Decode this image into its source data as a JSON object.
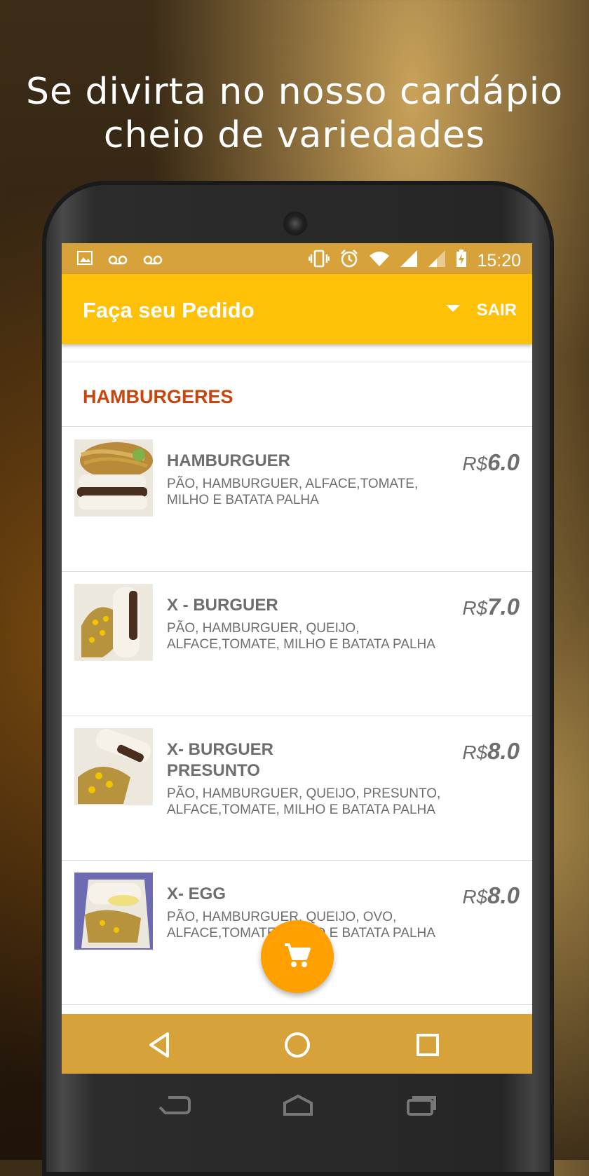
{
  "promo": {
    "headline_line1": "Se divirta no nosso cardápio",
    "headline_line2": "cheio de variedades"
  },
  "statusbar": {
    "time": "15:20",
    "icons_left": [
      "image-icon",
      "voicemail-icon",
      "voicemail-icon"
    ],
    "icons_right": [
      "vibrate-icon",
      "alarm-icon",
      "wifi-icon",
      "signal-icon",
      "signal-icon",
      "battery-charging-icon"
    ]
  },
  "appbar": {
    "title": "Faça seu Pedido",
    "dropdown_icon": "arrow-drop-down-icon",
    "logout_label": "SAIR"
  },
  "menu": {
    "category": "HAMBURGERES",
    "items": [
      {
        "name": "HAMBURGUER",
        "description": "PÃO, HAMBURGUER, ALFACE,TOMATE, MILHO E BATATA PALHA",
        "currency": "R$",
        "price": "6.0"
      },
      {
        "name": "X - BURGUER",
        "description": "PÃO, HAMBURGUER, QUEIJO, ALFACE,TOMATE, MILHO E BATATA PALHA",
        "currency": "R$",
        "price": "7.0"
      },
      {
        "name": "X- BURGUER PRESUNTO",
        "description": "PÃO, HAMBURGUER, QUEIJO, PRESUNTO, ALFACE,TOMATE, MILHO E BATATA PALHA",
        "currency": "R$",
        "price": "8.0"
      },
      {
        "name": "X- EGG",
        "description": "PÃO, HAMBURGUER, QUEIJO, OVO, ALFACE,TOMATE, MILHO E BATATA PALHA",
        "currency": "R$",
        "price": "8.0"
      }
    ]
  },
  "fab": {
    "icon": "cart-icon"
  },
  "navbar": {
    "icons": [
      "back-icon",
      "home-icon",
      "recents-icon"
    ]
  },
  "colors": {
    "accent": "#ffc107",
    "statusbar": "#d8a23a",
    "category": "#c8460e",
    "fab": "#ffa000"
  }
}
